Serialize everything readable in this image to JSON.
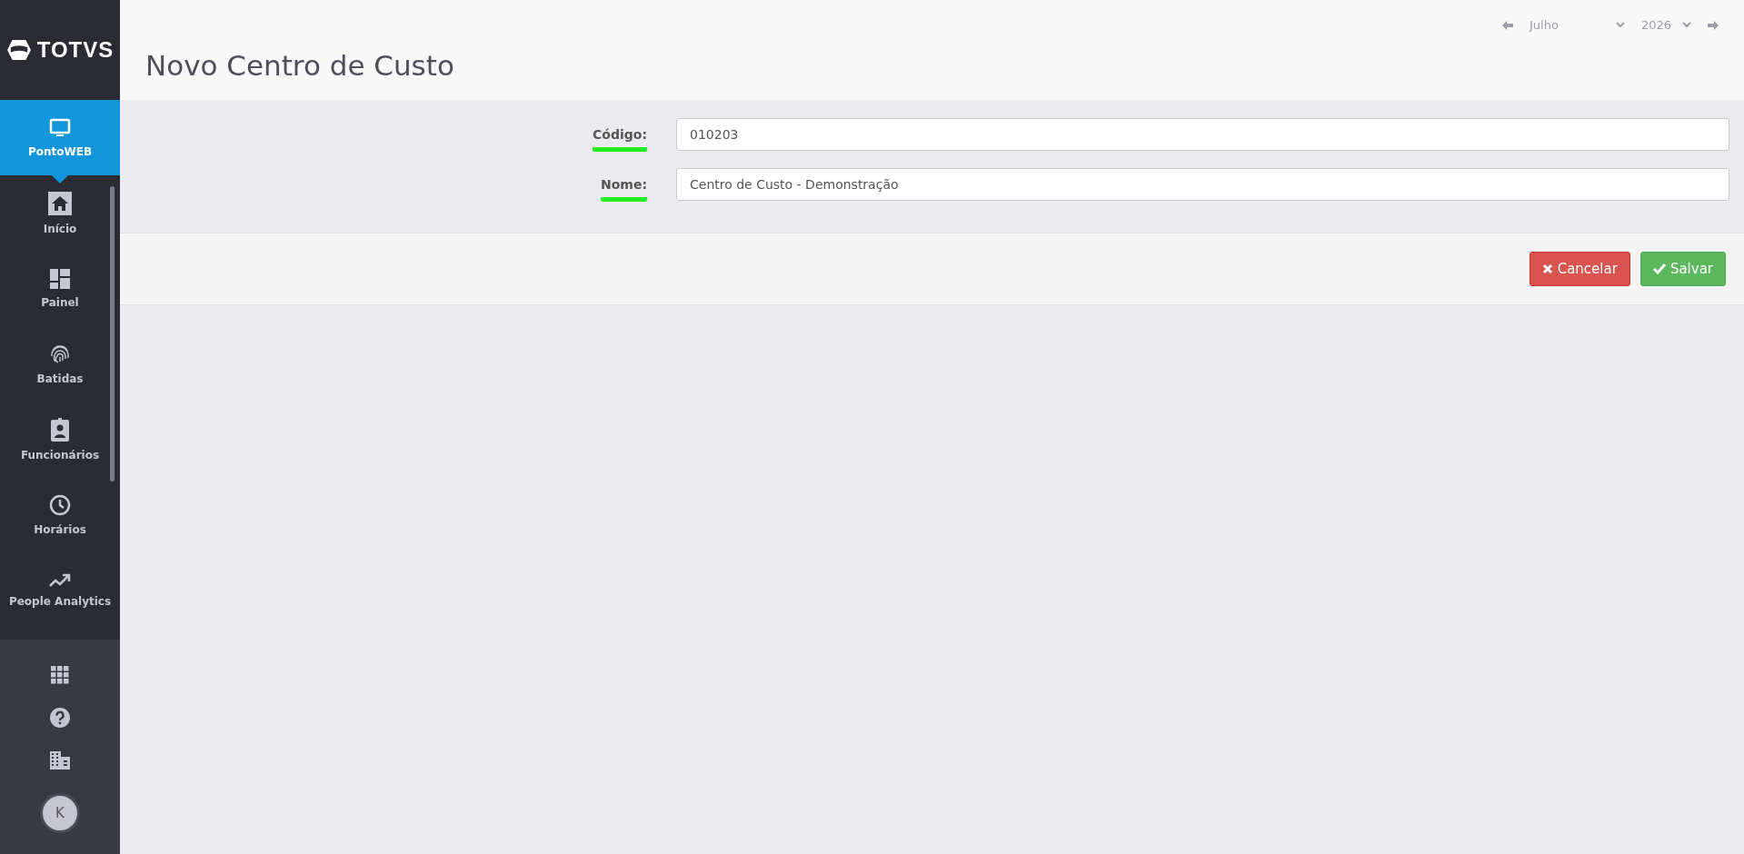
{
  "sidebar": {
    "logo": "TOTVS",
    "items": [
      {
        "label": "PontoWEB",
        "kind": "monitor",
        "selected": true
      },
      {
        "label": "Início",
        "kind": "home",
        "selected": false
      },
      {
        "label": "Painel",
        "kind": "dashboard",
        "selected": false
      },
      {
        "label": "Batidas",
        "kind": "fingerprint",
        "selected": false
      },
      {
        "label": "Funcionários",
        "kind": "badge",
        "selected": false
      },
      {
        "label": "Horários",
        "kind": "clock",
        "selected": false
      },
      {
        "label": "People Analytics",
        "kind": "trend",
        "selected": false
      }
    ],
    "bottom": [
      {
        "kind": "apps"
      },
      {
        "kind": "help"
      },
      {
        "kind": "building"
      },
      {
        "kind": "avatar",
        "initial": "K"
      }
    ]
  },
  "header": {
    "title": "Novo Centro de Custo",
    "month": "Julho",
    "year": "2026"
  },
  "form": {
    "fields": [
      {
        "label": "Código:",
        "value": "010203",
        "underlined": true
      },
      {
        "label": "Nome:",
        "value": "Centro de Custo - Demonstração",
        "underlined": true
      }
    ]
  },
  "actions": [
    {
      "kind": "cancel",
      "label": "Cancelar"
    },
    {
      "kind": "save",
      "label": "Salvar"
    }
  ]
}
